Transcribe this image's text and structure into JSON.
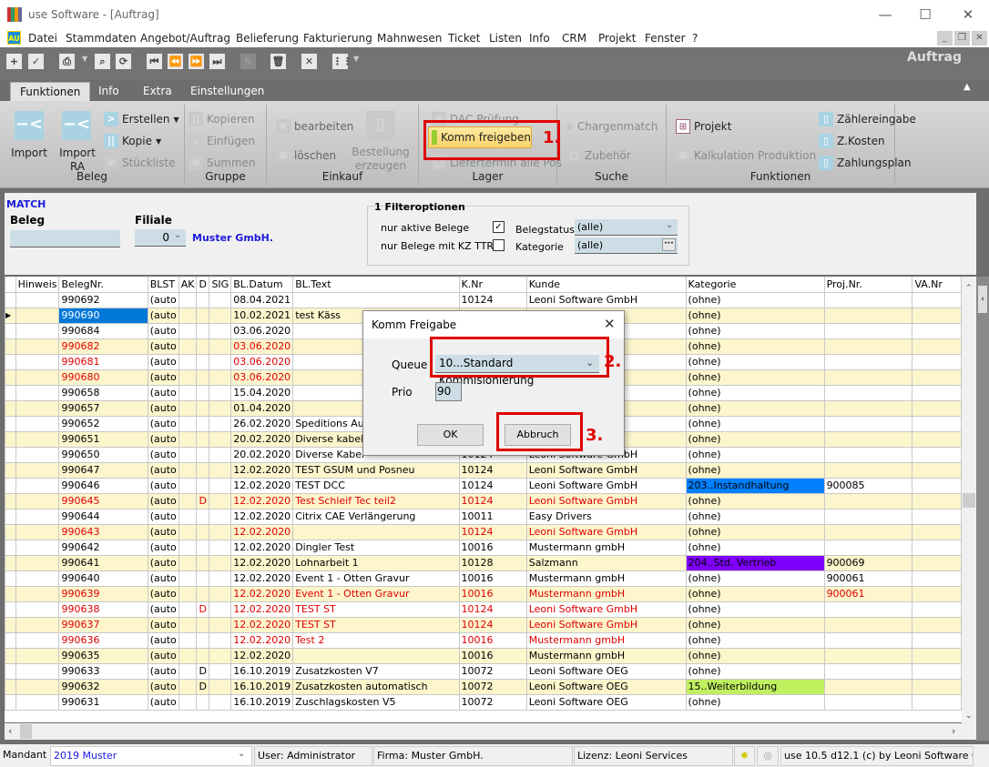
{
  "window": {
    "title": "use Software - [Auftrag]",
    "minimize": "—",
    "maximize": "☐",
    "close": "✕"
  },
  "menu": {
    "app_icon": "AU",
    "items": [
      "Datei",
      "Stammdaten",
      "Angebot/Auftrag",
      "Belieferung",
      "Fakturierung",
      "Mahnwesen",
      "Ticket",
      "Listen",
      "Info",
      "CRM",
      "Projekt",
      "Fenster",
      "?"
    ]
  },
  "toolbar": {
    "module_title": "Auftrag"
  },
  "ribbon": {
    "tabs": [
      "Funktionen",
      "Info",
      "Extra",
      "Einstellungen"
    ],
    "active_tab": "Funktionen",
    "beleg": {
      "label": "Beleg",
      "import": "Import",
      "import_ra": "Import RA",
      "erstellen": "Erstellen",
      "kopie": "Kopie",
      "stueckliste": "Stückliste"
    },
    "gruppe": {
      "label": "Gruppe",
      "kopieren": "Kopieren",
      "einfuegen": "Einfügen",
      "summen": "Summen"
    },
    "einkauf": {
      "label": "Einkauf",
      "bearbeiten": "bearbeiten",
      "loeschen": "löschen",
      "bestellung": "Bestellung erzeugen"
    },
    "lager": {
      "label": "Lager",
      "dac": "DAC Prüfung",
      "komm": "Komm freigeben",
      "liefertermin": "Liefertermin alle Pos"
    },
    "suche": {
      "label": "Suche",
      "chargenmatch": "Chargenmatch",
      "zubehoer": "Zubehör"
    },
    "funktionen": {
      "label": "Funktionen",
      "projekt": "Projekt",
      "kalkulation": "Kalkulation Produktion",
      "zaehlereingabe": "Zählereingabe",
      "zkosten": "Z.Kosten",
      "zahlungsplan": "Zahlungsplan"
    }
  },
  "filter": {
    "match": "MATCH",
    "beleg_label": "Beleg",
    "beleg_value": "",
    "filiale_label": "Filiale",
    "filiale_value": "0",
    "filiale_name": "Muster GmbH.",
    "options_title": "1 Filteroptionen",
    "nur_aktive": "nur aktive Belege",
    "nur_aktive_checked": true,
    "nur_kz": "nur Belege mit KZ TTR",
    "nur_kz_checked": false,
    "belegstatus_label": "Belegstatus",
    "belegstatus_value": "(alle)",
    "kategorie_label": "Kategorie",
    "kategorie_value": "(alle)"
  },
  "grid": {
    "columns": [
      "",
      "Hinweis",
      "BelegNr.",
      "BLST",
      "AK",
      "D",
      "SIG",
      "BL.Datum",
      "BL.Text",
      "K.Nr",
      "Kunde",
      "Kategorie",
      "Proj.Nr.",
      "VA.Nr"
    ],
    "selected_row": 1,
    "rows": [
      {
        "belegnr": "990692",
        "blst": "(auto",
        "d": "",
        "datum": "08.04.2021",
        "text": "",
        "knr": "10124",
        "kunde": "Leoni Software GmbH",
        "kategorie": "(ohne)",
        "projnr": "",
        "red": false
      },
      {
        "belegnr": "990690",
        "blst": "(auto",
        "d": "",
        "datum": "10.02.2021",
        "text": "test Käss",
        "knr": "",
        "kunde": "",
        "kategorie": "(ohne)",
        "projnr": "",
        "red": false
      },
      {
        "belegnr": "990684",
        "blst": "(auto",
        "d": "",
        "datum": "03.06.2020",
        "text": "",
        "knr": "",
        "kunde": "",
        "kategorie": "(ohne)",
        "projnr": "",
        "red": false
      },
      {
        "belegnr": "990682",
        "blst": "(auto",
        "d": "",
        "datum": "03.06.2020",
        "text": "",
        "knr": "",
        "kunde": "",
        "kategorie": "(ohne)",
        "projnr": "",
        "red": true
      },
      {
        "belegnr": "990681",
        "blst": "(auto",
        "d": "",
        "datum": "03.06.2020",
        "text": "",
        "knr": "",
        "kunde": "",
        "kategorie": "(ohne)",
        "projnr": "",
        "red": true
      },
      {
        "belegnr": "990680",
        "blst": "(auto",
        "d": "",
        "datum": "03.06.2020",
        "text": "",
        "knr": "",
        "kunde": "",
        "kategorie": "(ohne)",
        "projnr": "",
        "red": true
      },
      {
        "belegnr": "990658",
        "blst": "(auto",
        "d": "",
        "datum": "15.04.2020",
        "text": "",
        "knr": "",
        "kunde": "",
        "kategorie": "(ohne)",
        "projnr": "",
        "red": false
      },
      {
        "belegnr": "990657",
        "blst": "(auto",
        "d": "",
        "datum": "01.04.2020",
        "text": "",
        "knr": "",
        "kunde": "",
        "kategorie": "(ohne)",
        "projnr": "",
        "red": false
      },
      {
        "belegnr": "990652",
        "blst": "(auto",
        "d": "",
        "datum": "26.02.2020",
        "text": "Speditions Aufwand",
        "knr": "",
        "kunde": "",
        "kategorie": "(ohne)",
        "projnr": "",
        "red": false
      },
      {
        "belegnr": "990651",
        "blst": "(auto",
        "d": "",
        "datum": "20.02.2020",
        "text": "Diverse kabel 2",
        "knr": "",
        "kunde": "",
        "kategorie": "(ohne)",
        "projnr": "",
        "red": false
      },
      {
        "belegnr": "990650",
        "blst": "(auto",
        "d": "",
        "datum": "20.02.2020",
        "text": "Diverse Kabel",
        "knr": "10124",
        "kunde": "Leoni Software GmbH",
        "kategorie": "(ohne)",
        "projnr": "",
        "red": false
      },
      {
        "belegnr": "990647",
        "blst": "(auto",
        "d": "",
        "datum": "12.02.2020",
        "text": "TEST GSUM und Posneu",
        "knr": "10124",
        "kunde": "Leoni Software GmbH",
        "kategorie": "(ohne)",
        "projnr": "",
        "red": false
      },
      {
        "belegnr": "990646",
        "blst": "(auto",
        "d": "",
        "datum": "12.02.2020",
        "text": "TEST DCC",
        "knr": "10124",
        "kunde": "Leoni Software GmbH",
        "kategorie": "203..Instandhaltung",
        "kat_color": "#0080ff",
        "projnr": "900085",
        "red": false
      },
      {
        "belegnr": "990645",
        "blst": "(auto",
        "d": "D",
        "datum": "12.02.2020",
        "text": "Test Schleif Tec teil2",
        "knr": "10124",
        "kunde": "Leoni Software GmbH",
        "kategorie": "(ohne)",
        "projnr": "",
        "red": true
      },
      {
        "belegnr": "990644",
        "blst": "(auto",
        "d": "",
        "datum": "12.02.2020",
        "text": "Citrix CAE Verlängerung",
        "knr": "10011",
        "kunde": "Easy Drivers",
        "kategorie": "(ohne)",
        "projnr": "",
        "red": false
      },
      {
        "belegnr": "990643",
        "blst": "(auto",
        "d": "",
        "datum": "12.02.2020",
        "text": "",
        "knr": "10124",
        "kunde": "Leoni Software GmbH",
        "kategorie": "(ohne)",
        "projnr": "",
        "red": true
      },
      {
        "belegnr": "990642",
        "blst": "(auto",
        "d": "",
        "datum": "12.02.2020",
        "text": "Dingler Test",
        "knr": "10016",
        "kunde": "Mustermann gmbH",
        "kategorie": "(ohne)",
        "projnr": "",
        "red": false
      },
      {
        "belegnr": "990641",
        "blst": "(auto",
        "d": "",
        "datum": "12.02.2020",
        "text": "Lohnarbeit 1",
        "knr": "10128",
        "kunde": "Salzmann",
        "kategorie": "204..Std. Vertrieb",
        "kat_color": "#8000ff",
        "projnr": "900069",
        "red": false
      },
      {
        "belegnr": "990640",
        "blst": "(auto",
        "d": "",
        "datum": "12.02.2020",
        "text": "Event 1 - Otten Gravur",
        "knr": "10016",
        "kunde": "Mustermann gmbH",
        "kategorie": "(ohne)",
        "projnr": "900061",
        "red": false
      },
      {
        "belegnr": "990639",
        "blst": "(auto",
        "d": "",
        "datum": "12.02.2020",
        "text": "Event 1 - Otten Gravur",
        "knr": "10016",
        "kunde": "Mustermann gmbH",
        "kategorie": "(ohne)",
        "projnr": "900061",
        "red": true
      },
      {
        "belegnr": "990638",
        "blst": "(auto",
        "d": "D",
        "datum": "12.02.2020",
        "text": "TEST ST",
        "knr": "10124",
        "kunde": "Leoni Software GmbH",
        "kategorie": "(ohne)",
        "projnr": "",
        "red": true
      },
      {
        "belegnr": "990637",
        "blst": "(auto",
        "d": "",
        "datum": "12.02.2020",
        "text": "TEST ST",
        "knr": "10124",
        "kunde": "Leoni Software GmbH",
        "kategorie": "(ohne)",
        "projnr": "",
        "red": true
      },
      {
        "belegnr": "990636",
        "blst": "(auto",
        "d": "",
        "datum": "12.02.2020",
        "text": "Test 2",
        "knr": "10016",
        "kunde": "Mustermann gmbH",
        "kategorie": "(ohne)",
        "projnr": "",
        "red": true
      },
      {
        "belegnr": "990635",
        "blst": "(auto",
        "d": "",
        "datum": "12.02.2020",
        "text": "",
        "knr": "10016",
        "kunde": "Mustermann gmbH",
        "kategorie": "(ohne)",
        "projnr": "",
        "red": false
      },
      {
        "belegnr": "990633",
        "blst": "(auto",
        "d": "D",
        "datum": "16.10.2019",
        "text": "Zusatzkosten V7",
        "knr": "10072",
        "kunde": "Leoni Software OEG",
        "kategorie": "(ohne)",
        "projnr": "",
        "red": false
      },
      {
        "belegnr": "990632",
        "blst": "(auto",
        "d": "D",
        "datum": "16.10.2019",
        "text": "Zusatzkosten automatisch",
        "knr": "10072",
        "kunde": "Leoni Software OEG",
        "kategorie": "15..Weiterbildung",
        "kat_color": "#c0f060",
        "projnr": "",
        "red": false
      },
      {
        "belegnr": "990631",
        "blst": "(auto",
        "d": "",
        "datum": "16.10.2019",
        "text": "Zuschlagskosten V5",
        "knr": "10072",
        "kunde": "Leoni Software OEG",
        "kategorie": "(ohne)",
        "projnr": "",
        "red": false
      }
    ]
  },
  "dialog": {
    "title": "Komm Freigabe",
    "queue_label": "Queue",
    "queue_value": "10...Standard Kommisionierung",
    "prio_label": "Prio",
    "prio_value": "90",
    "ok": "OK",
    "cancel": "Abbruch"
  },
  "annotations": {
    "step1": "1.",
    "step2": "2.",
    "step3": "3."
  },
  "status": {
    "mandant_label": "Mandant",
    "mandant_value": "2019 Muster",
    "user": "User: Administrator",
    "firma": "Firma: Muster GmbH.",
    "lizenz": "Lizenz: Leoni Services",
    "version": "use 10.5 d12.1 (c) by Leoni Software GmbH"
  },
  "colors": {
    "accent": "#0078d7",
    "highlight_row": "#fdf5cc",
    "red_text": "#e00000",
    "annotation": "#e00000"
  }
}
